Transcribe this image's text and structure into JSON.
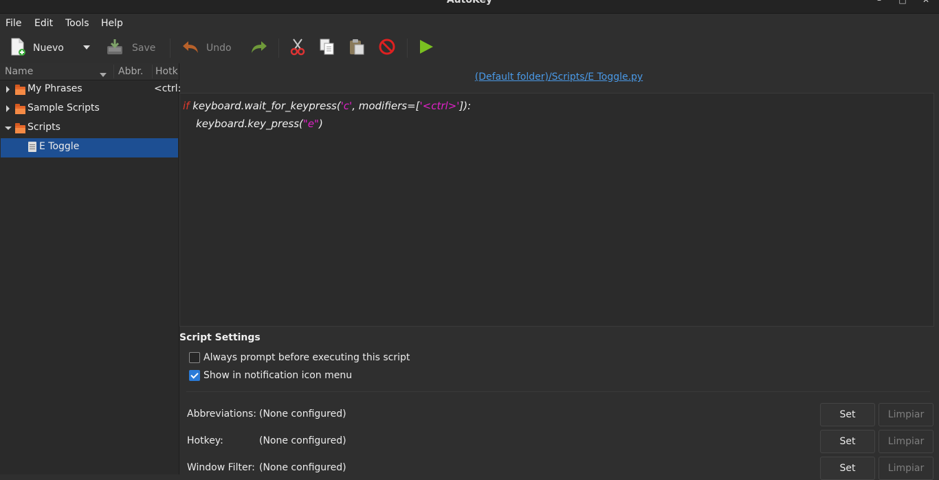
{
  "window": {
    "title": "AutoKey",
    "controls": {
      "minimize": "–",
      "maximize": "□",
      "close": "✕"
    }
  },
  "menu": [
    "File",
    "Edit",
    "Tools",
    "Help"
  ],
  "toolbar": {
    "new_label": "Nuevo",
    "save_label": "Save",
    "undo_label": "Undo",
    "icons": [
      "new-file-icon",
      "dropdown-arrow-icon",
      "save-icon",
      "undo-icon",
      "redo-icon",
      "cut-icon",
      "copy-icon",
      "paste-icon",
      "delete-icon",
      "run-icon"
    ]
  },
  "tree": {
    "columns": [
      "Name",
      "Abbr.",
      "Hotk"
    ],
    "items": [
      {
        "label": "My Phrases",
        "hotkey": "<ctrl:"
      },
      {
        "label": "Sample Scripts"
      },
      {
        "label": "Scripts"
      },
      {
        "label": "E Toggle"
      }
    ]
  },
  "editor": {
    "path": "(Default folder)/Scripts/E Toggle.py",
    "line1": {
      "kw": "if",
      "a": " keyboard.wait_for_keypress(",
      "s1": "'c'",
      "b": ", modifiers=[",
      "s2": "'<ctrl>'",
      "c": "]):"
    },
    "line2": {
      "a": "    keyboard.key_press(",
      "s": "\"e\"",
      "b": ")"
    }
  },
  "settings": {
    "title": "Script Settings",
    "always_prompt": {
      "label": "Always prompt before executing this script",
      "checked": false
    },
    "show_notification": {
      "label": "Show in notification icon menu",
      "checked": true
    },
    "rows": [
      {
        "label": "Abbreviations:",
        "value": "(None configured)",
        "set": "Set",
        "clear": "Limpiar"
      },
      {
        "label": "Hotkey:",
        "value": "(None configured)",
        "set": "Set",
        "clear": "Limpiar"
      },
      {
        "label": "Window Filter:",
        "value": "(None configured)",
        "set": "Set",
        "clear": "Limpiar"
      }
    ]
  },
  "colors": {
    "selection": "#1d4f93",
    "link": "#4a9ae8",
    "keyword": "#e0392c",
    "string": "#e021c8",
    "accent": "#2a7bd8"
  }
}
